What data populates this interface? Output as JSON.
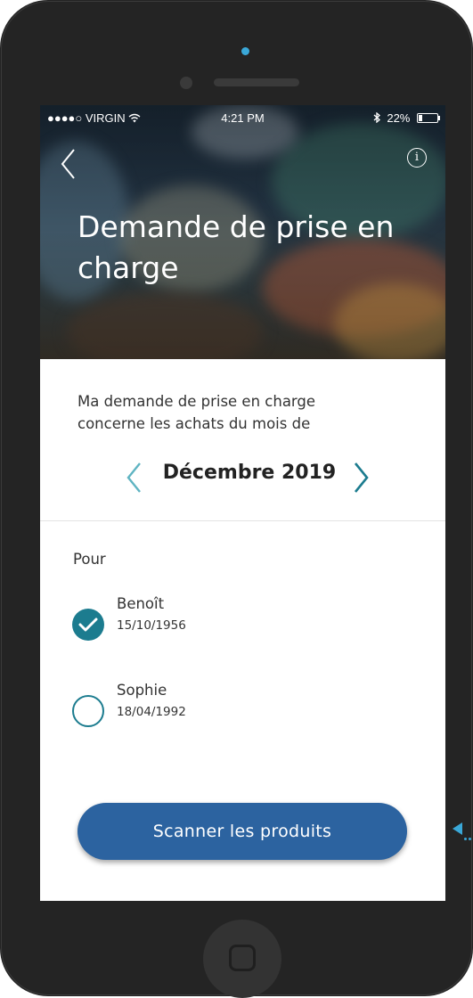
{
  "status_bar": {
    "carrier": "●●●●○ VIRGIN",
    "time": "4:21 PM",
    "battery": "22%"
  },
  "header": {
    "title_line1": "Demande de prise en",
    "title_line2": "charge"
  },
  "intro": {
    "line1": "Ma demande de prise en charge",
    "line2": "concerne les achats du mois de"
  },
  "month_selector": {
    "label": "Décembre 2019"
  },
  "beneficiaries": {
    "label": "Pour",
    "people": [
      {
        "name": "Benoît",
        "birthdate": "15/10/1956",
        "selected": true
      },
      {
        "name": "Sophie",
        "birthdate": "18/04/1992",
        "selected": false
      }
    ]
  },
  "actions": {
    "scan_label": "Scanner les produits"
  },
  "colors": {
    "accent_teal": "#1c7c8f",
    "button_blue": "#2c63a0",
    "phone_body": "#242424",
    "chevron_teal": "#4aa9b8"
  },
  "icons": {
    "back": "chevron-left-icon",
    "info": "info-icon",
    "wifi": "wifi-icon",
    "bluetooth": "bluetooth-icon",
    "battery": "battery-icon",
    "prev_month": "chevron-left-icon",
    "next_month": "chevron-right-icon",
    "check": "check-icon"
  }
}
